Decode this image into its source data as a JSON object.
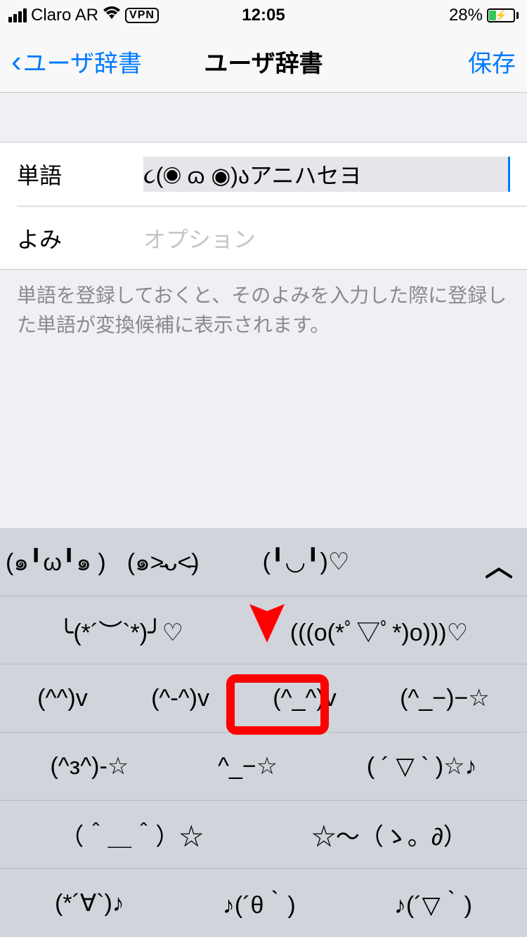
{
  "status": {
    "carrier": "Claro AR",
    "vpn": "VPN",
    "time": "12:05",
    "battery_pct": "28%"
  },
  "nav": {
    "back_label": "ユーザ辞書",
    "title": "ユーザ辞書",
    "save_label": "保存"
  },
  "form": {
    "word_label": "単語",
    "word_value": "૮(◉ ɷ ◉)აアニハセヨ",
    "reading_label": "よみ",
    "reading_placeholder": "オプション",
    "helper": "単語を登録しておくと、そのよみを入力した際に登録した単語が変換候補に表示されます。"
  },
  "keyboard": {
    "row1": [
      "(๑╹ω╹๑ )",
      "(๑˃̵ᴗ˂̵)",
      "(╹◡╹)♡"
    ],
    "row2": [
      "╰(*´︶`*)╯♡",
      "(((o(*ﾟ▽ﾟ*)o)))♡"
    ],
    "row3": [
      "(^^)v",
      "(^-^)v",
      "(^_^)v",
      "(^_−)−☆"
    ],
    "row4": [
      "(^з^)-☆",
      "^_−☆",
      "( ´ ▽ ` )☆♪"
    ],
    "row5": [
      "（＾＿＾）☆",
      "☆〜（ゝ。∂）"
    ],
    "row6": [
      "(*´∀`)♪",
      "♪(´θ｀)",
      "♪(´▽｀)"
    ]
  }
}
